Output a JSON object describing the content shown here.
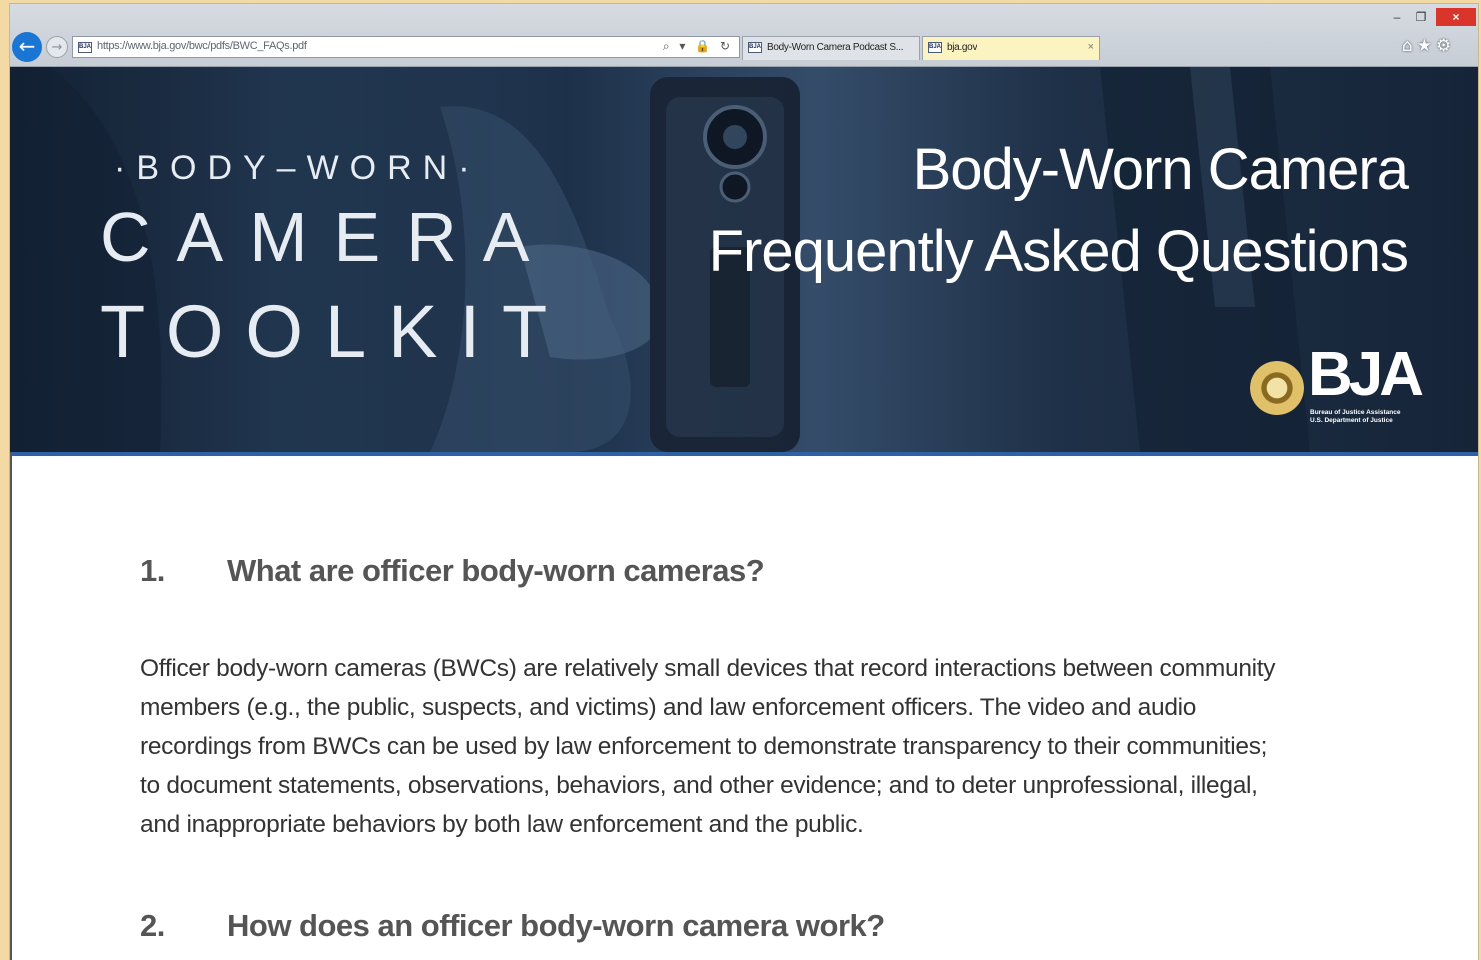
{
  "browser": {
    "window_controls": {
      "minimize": "–",
      "maximize": "❐",
      "close": "×"
    },
    "address": {
      "url": "https://www.bja.gov/bwc/pdfs/BWC_FAQs.pdf",
      "favicon_text": "BJA",
      "icons": "⌕ ▾ 🔒 ↻"
    },
    "tabs": [
      {
        "title": "Body-Worn Camera Podcast S...",
        "favicon_text": "BJA",
        "active": false
      },
      {
        "title": "bja.gov",
        "favicon_text": "BJA",
        "active": true,
        "close": "×"
      }
    ],
    "toolbar_icons": {
      "home": "⌂",
      "favorites": "★",
      "settings": "⚙"
    },
    "nav": {
      "back": "←",
      "forward": "→"
    }
  },
  "banner": {
    "logo": {
      "line1": "·BODY–WORN·",
      "line2": "CAMERA",
      "line3": "TOOLKIT"
    },
    "title_line1": "Body-Worn Camera",
    "title_line2": "Frequently Asked Questions",
    "bja": {
      "mark": "BJA",
      "sub_line1": "Bureau of Justice Assistance",
      "sub_line2": "U.S. Department of Justice"
    }
  },
  "faq": [
    {
      "number": "1.",
      "question": "What are officer body-worn cameras?",
      "answer_lines": [
        "Officer body-worn cameras (BWCs) are relatively small devices that record interactions between community",
        "members (e.g., the public, suspects, and victims) and law enforcement officers. The video and audio",
        "recordings from BWCs can be used by law enforcement to demonstrate transparency to their communities;",
        "to document statements, observations, behaviors, and other evidence; and to deter unprofessional, illegal,",
        "and inappropriate behaviors by both law enforcement and the public."
      ]
    },
    {
      "number": "2.",
      "question": "How does an officer body-worn camera work?"
    }
  ],
  "colors": {
    "page_background": "#f3d9a4",
    "banner_dark": "#1b2c42",
    "banner_rule": "#2d63a5",
    "question_text": "#555555",
    "answer_text": "#333333",
    "close_button": "#d9352a",
    "back_button": "#1a76d2"
  }
}
